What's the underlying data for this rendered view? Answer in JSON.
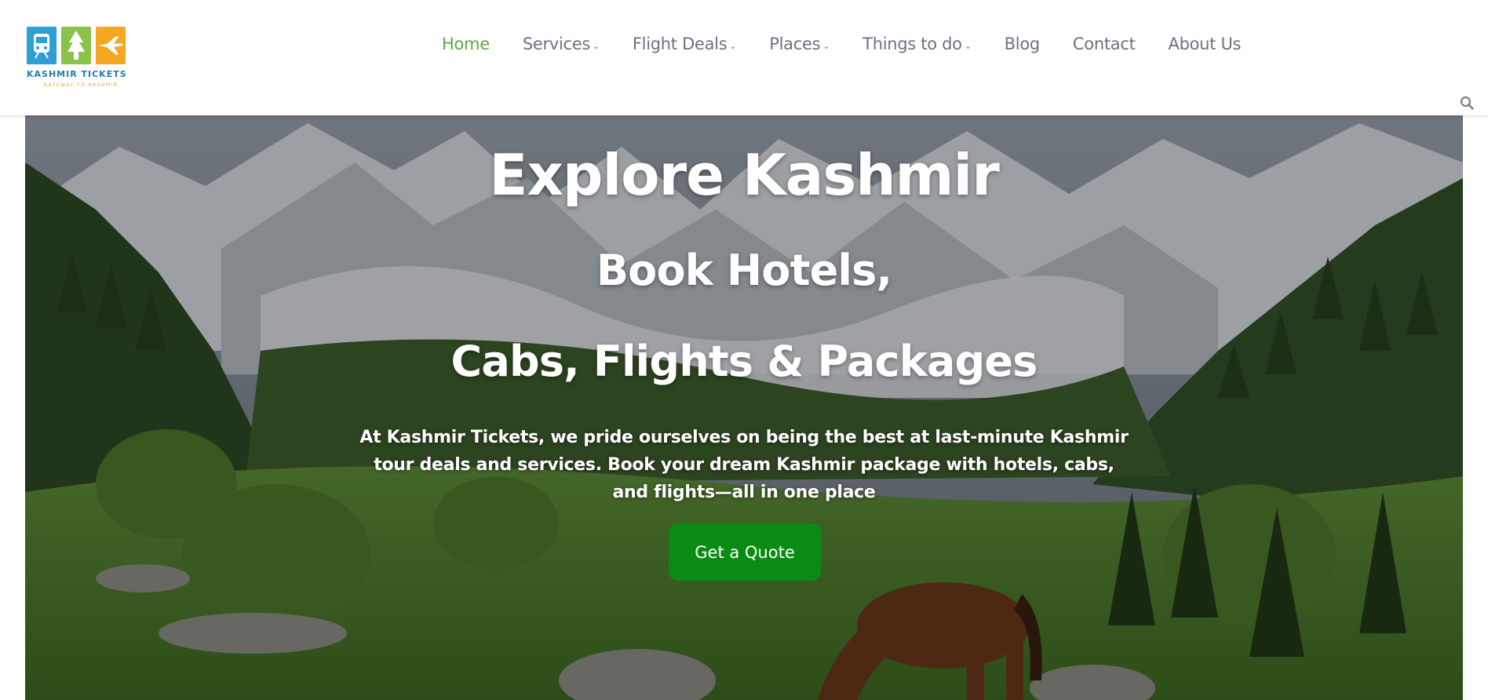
{
  "brand": {
    "name": "KASHMIR TICKETS",
    "tagline": "GATEWAY TO KASHMIR",
    "colors": {
      "blue": "#2e9fd4",
      "green": "#8bc34a",
      "orange": "#f5a623"
    }
  },
  "nav": {
    "items": [
      {
        "label": "Home",
        "active": true,
        "has_dropdown": false
      },
      {
        "label": "Services",
        "active": false,
        "has_dropdown": true
      },
      {
        "label": "Flight Deals",
        "active": false,
        "has_dropdown": true
      },
      {
        "label": "Places",
        "active": false,
        "has_dropdown": true
      },
      {
        "label": "Things to do",
        "active": false,
        "has_dropdown": true
      },
      {
        "label": "Blog",
        "active": false,
        "has_dropdown": false
      },
      {
        "label": "Contact",
        "active": false,
        "has_dropdown": false
      },
      {
        "label": "About Us",
        "active": false,
        "has_dropdown": false
      }
    ],
    "active_color": "#5fa942",
    "search_icon": "search-icon"
  },
  "hero": {
    "title": "Explore Kashmir",
    "subtitle_line1": "Book Hotels,",
    "subtitle_line2": "Cabs, Flights & Packages",
    "description": "At Kashmir Tickets, we pride ourselves on being the best at last-minute Kashmir tour deals and services. Book your dream Kashmir package with hotels, cabs, and flights—all in one place",
    "cta_label": "Get a Quote",
    "cta_color": "#0a8c12"
  }
}
